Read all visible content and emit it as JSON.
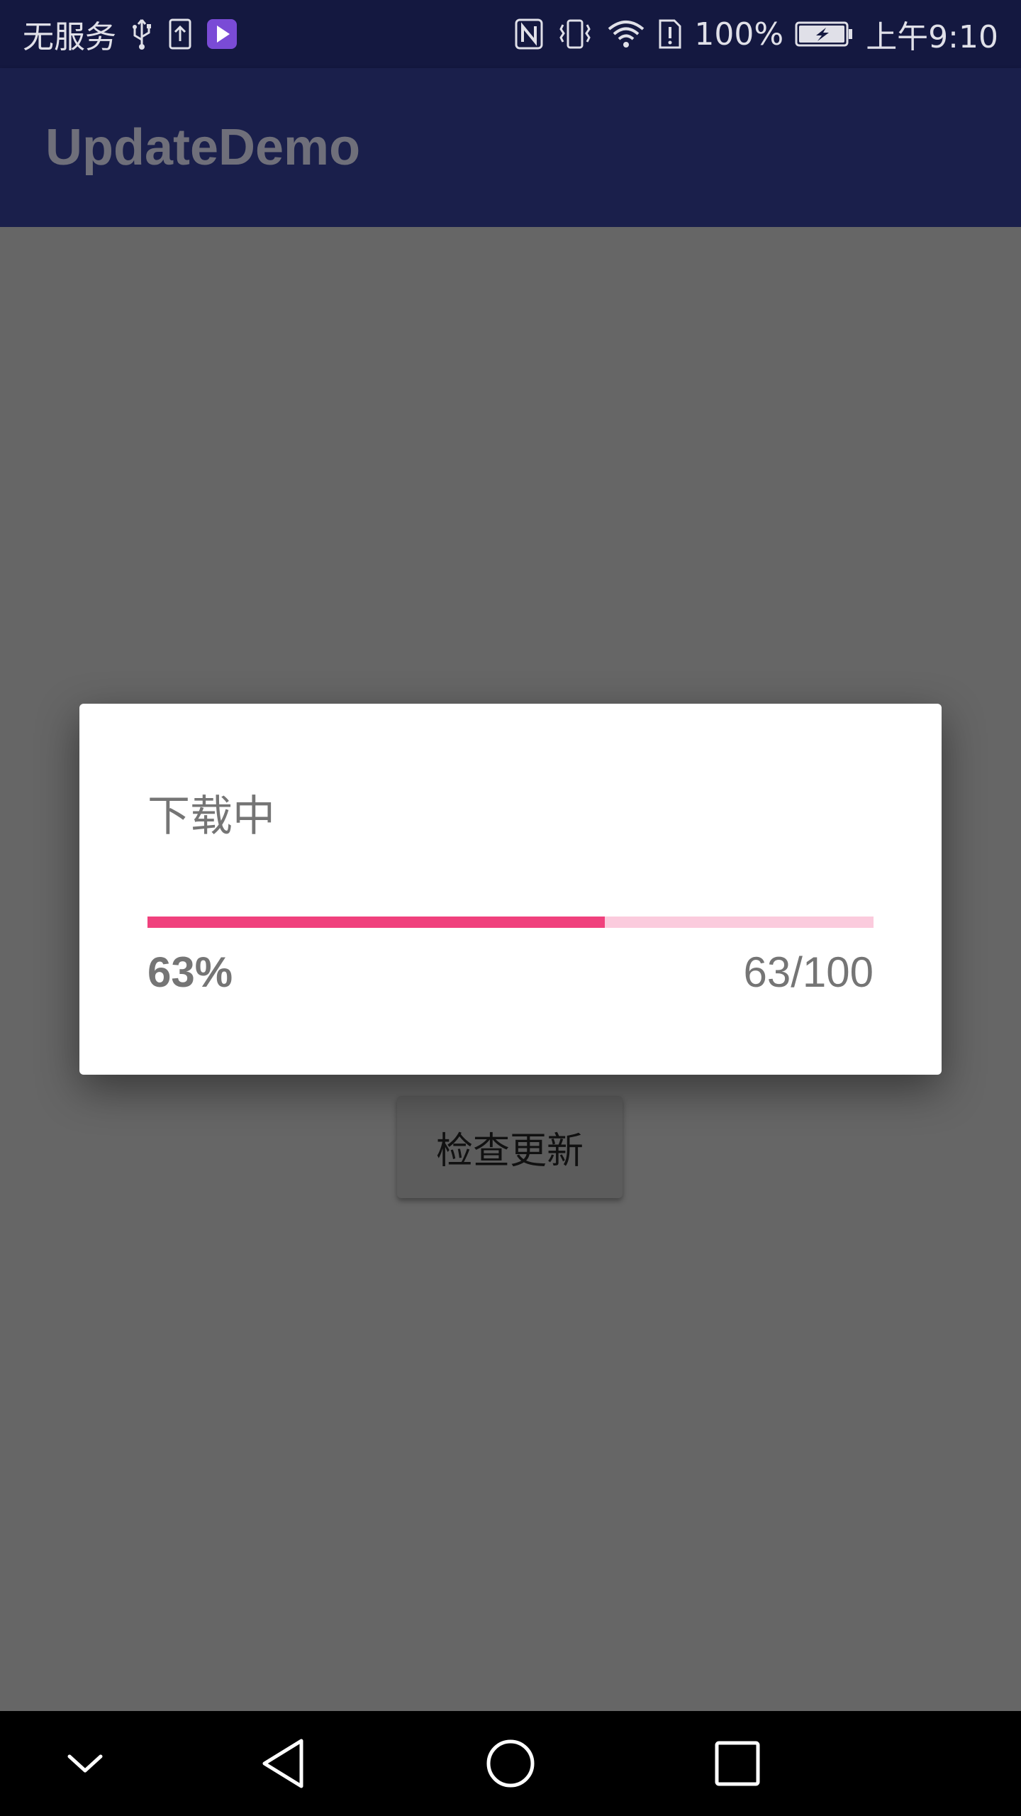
{
  "status_bar": {
    "carrier": "无服务",
    "battery_percent": "100%",
    "time": "上午9:10",
    "icons_left": [
      "usb-icon",
      "upload-icon",
      "media-app-icon"
    ],
    "icons_right": [
      "nfc-icon",
      "vibrate-icon",
      "wifi-icon",
      "sim-alert-icon",
      "battery-charging-icon"
    ]
  },
  "app_bar": {
    "title": "UpdateDemo"
  },
  "main": {
    "check_update_label": "检查更新"
  },
  "dialog": {
    "title": "下载中",
    "progress": {
      "percent_label": "63%",
      "count_label": "63/100",
      "value": 63,
      "max": 100
    },
    "colors": {
      "progress_fill": "#f0417d",
      "progress_track": "#fbcbdd"
    }
  },
  "nav_bar": {
    "icons": [
      "chevron-down-icon",
      "back-icon",
      "home-icon",
      "recents-icon"
    ]
  }
}
